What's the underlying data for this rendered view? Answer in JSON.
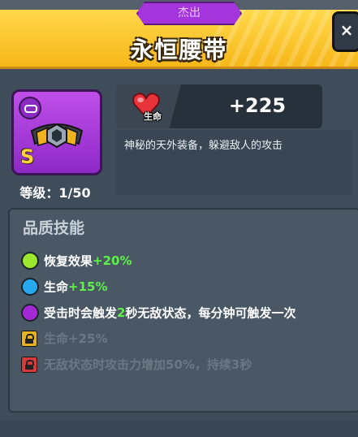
{
  "header": {
    "rarity": "杰出",
    "title": "永恒腰带",
    "close_label": "×"
  },
  "item": {
    "grade": "S",
    "level": "等级：1/50",
    "stat_label": "生命",
    "stat_value": "+225",
    "description": "神秘的天外装备，躲避敌人的攻击"
  },
  "skills": {
    "title": "品质技能",
    "items": [
      {
        "prefix": "恢复效果",
        "bonus": "+20%",
        "suffix": "",
        "color": "#9be82e",
        "locked": false
      },
      {
        "prefix": "生命",
        "bonus": "+15%",
        "suffix": "",
        "color": "#27a9f0",
        "locked": false
      },
      {
        "prefix": "受击时会触发",
        "bonus": "2",
        "suffix": "秒无敌状态，每分钟可触发一次",
        "color": "#a528d6",
        "locked": false
      },
      {
        "prefix": "生命+25%",
        "bonus": "",
        "suffix": "",
        "color": "#e6b21f",
        "locked": true
      },
      {
        "prefix": "无敌状态时攻击力增加50%，持续3秒",
        "bonus": "",
        "suffix": "",
        "color": "#d73a3a",
        "locked": true
      }
    ]
  }
}
